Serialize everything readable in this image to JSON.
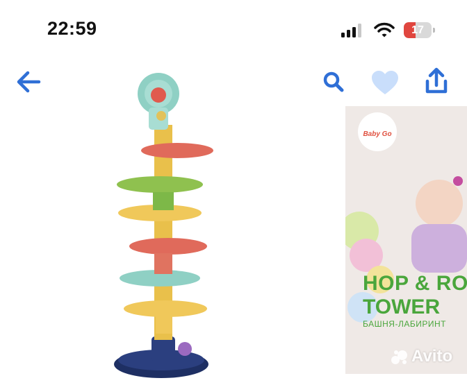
{
  "status_bar": {
    "time": "22:59",
    "battery_level": "17",
    "battery_fraction": 0.17,
    "icons": [
      "signal-icon",
      "wifi-icon",
      "battery-icon"
    ]
  },
  "header": {
    "icons": [
      "back-arrow-icon",
      "search-icon",
      "heart-icon",
      "share-icon"
    ],
    "accent_color": "#2f6fd6",
    "favorite_color": "#c9defb"
  },
  "gallery": {
    "box_brand": "Baby Go",
    "box_title_line1": "HOP & RO",
    "box_title_line2": "TOWER",
    "box_subtitle": "БАШНЯ-ЛАБИРИНТ",
    "watermark": "Avito"
  }
}
